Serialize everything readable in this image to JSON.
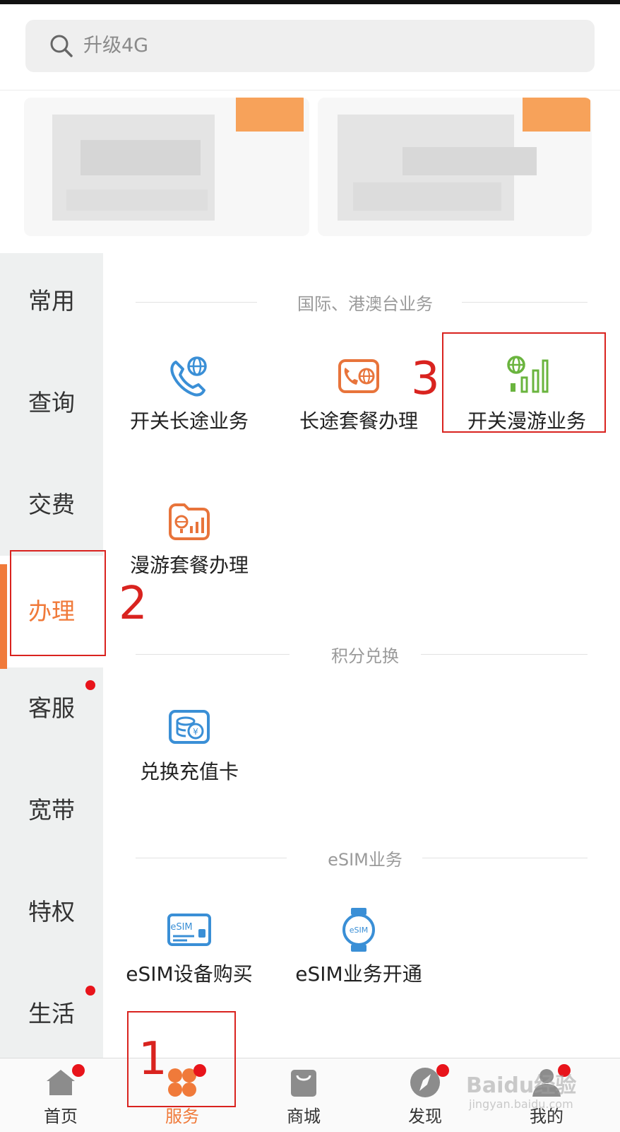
{
  "search": {
    "placeholder": "升级4G"
  },
  "sidebar": {
    "items": [
      {
        "label": "常用"
      },
      {
        "label": "查询"
      },
      {
        "label": "交费"
      },
      {
        "label": "办理",
        "active": true
      },
      {
        "label": "客服",
        "badge": true
      },
      {
        "label": "宽带"
      },
      {
        "label": "特权"
      },
      {
        "label": "生活",
        "badge": true
      }
    ]
  },
  "sections": [
    {
      "title": "国际、港澳台业务",
      "items": [
        {
          "label": "开关长途业务",
          "icon": "phone-globe-icon"
        },
        {
          "label": "长途套餐办理",
          "icon": "phone-globe-card-icon"
        },
        {
          "label": "开关漫游业务",
          "icon": "globe-signal-icon"
        },
        {
          "label": "漫游套餐办理",
          "icon": "roaming-card-icon"
        }
      ]
    },
    {
      "title": "积分兑换",
      "items": [
        {
          "label": "兑换充值卡",
          "icon": "coin-card-icon"
        }
      ]
    },
    {
      "title": "eSIM业务",
      "items": [
        {
          "label": "eSIM设备购买",
          "icon": "esim-card-icon"
        },
        {
          "label": "eSIM业务开通",
          "icon": "esim-watch-icon"
        }
      ]
    }
  ],
  "tabbar": {
    "items": [
      {
        "label": "首页",
        "icon": "home-icon",
        "badge": true
      },
      {
        "label": "服务",
        "icon": "service-grid-icon",
        "badge": true,
        "active": true
      },
      {
        "label": "商城",
        "icon": "shopping-bag-icon"
      },
      {
        "label": "发现",
        "icon": "compass-icon",
        "badge": true
      },
      {
        "label": "我的",
        "icon": "profile-icon",
        "badge": true
      }
    ]
  },
  "annotations": [
    "1",
    "2",
    "3"
  ],
  "watermark": {
    "brand": "Baidu经验",
    "url": "jingyan.baidu.com"
  },
  "colors": {
    "accent": "#f07a3a",
    "annotation": "#d9231f",
    "badge": "#e8141b",
    "icon_blue": "#3a8fd6",
    "icon_orange": "#e8743b",
    "icon_green": "#6ab43e"
  }
}
